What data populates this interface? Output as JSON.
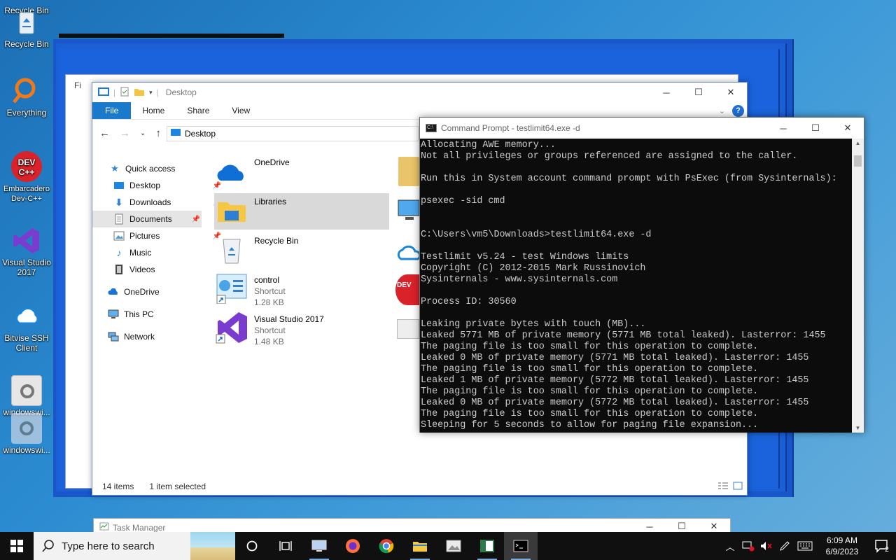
{
  "desktop": {
    "icons": [
      {
        "label": "Recycle Bin"
      },
      {
        "label": "Recycle Bin"
      },
      {
        "label": "Everything"
      },
      {
        "label": "Embarcadero Dev-C++"
      },
      {
        "label": "Visual Studio 2017"
      },
      {
        "label": "Bitvise SSH Client"
      },
      {
        "label": "windowswi..."
      },
      {
        "label": "windowswi..."
      }
    ]
  },
  "explorer": {
    "title": "Desktop",
    "back_title": "Fi",
    "ribbon_tabs": [
      "File",
      "Home",
      "Share",
      "View"
    ],
    "address": "Desktop",
    "nav": [
      {
        "label": "Quick access"
      },
      {
        "label": "Desktop"
      },
      {
        "label": "Downloads"
      },
      {
        "label": "Documents"
      },
      {
        "label": "Pictures"
      },
      {
        "label": "Music"
      },
      {
        "label": "Videos"
      },
      {
        "label": "OneDrive"
      },
      {
        "label": "This PC"
      },
      {
        "label": "Network"
      }
    ],
    "items": [
      {
        "name": "OneDrive",
        "type": "",
        "size": ""
      },
      {
        "name": "Libraries",
        "type": "",
        "size": ""
      },
      {
        "name": "Recycle Bin",
        "type": "",
        "size": ""
      },
      {
        "name": "control",
        "type": "Shortcut",
        "size": "1.28 KB"
      },
      {
        "name": "Visual Studio 2017",
        "type": "Shortcut",
        "size": "1.48 KB"
      }
    ],
    "status": {
      "count": "14 items",
      "selection": "1 item selected"
    }
  },
  "cmd": {
    "title": "Command Prompt - testlimit64.exe  -d",
    "lines": [
      "Allocating AWE memory...",
      "Not all privileges or groups referenced are assigned to the caller.",
      "",
      "Run this in System account command prompt with PsExec (from Sysinternals):",
      "",
      "psexec -sid cmd",
      "",
      "",
      "C:\\Users\\vm5\\Downloads>testlimit64.exe -d",
      "",
      "Testlimit v5.24 - test Windows limits",
      "Copyright (C) 2012-2015 Mark Russinovich",
      "Sysinternals - www.sysinternals.com",
      "",
      "Process ID: 30560",
      "",
      "Leaking private bytes with touch (MB)...",
      "Leaked 5771 MB of private memory (5771 MB total leaked). Lasterror: 1455",
      "The paging file is too small for this operation to complete.",
      "Leaked 0 MB of private memory (5771 MB total leaked). Lasterror: 1455",
      "The paging file is too small for this operation to complete.",
      "Leaked 1 MB of private memory (5772 MB total leaked). Lasterror: 1455",
      "The paging file is too small for this operation to complete.",
      "Leaked 0 MB of private memory (5772 MB total leaked). Lasterror: 1455",
      "The paging file is too small for this operation to complete.",
      "Sleeping for 5 seconds to allow for paging file expansion..."
    ]
  },
  "taskmgr": {
    "title": "Task Manager"
  },
  "taskbar": {
    "search_placeholder": "Type here to search",
    "time": "6:09 AM",
    "date": "6/9/2023",
    "notification_count": "2"
  }
}
